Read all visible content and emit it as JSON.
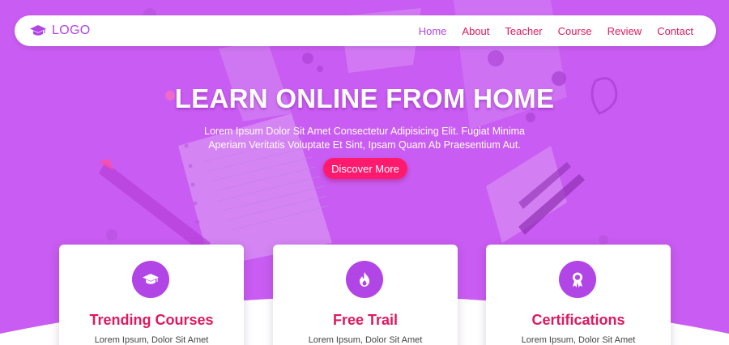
{
  "colors": {
    "hero_bg": "#c95cf2",
    "accent": "#b145e6",
    "brand_pink": "#e0185f",
    "cta_bg": "#ff1a6e"
  },
  "logo": {
    "icon": "graduation-cap-icon",
    "text": "LOGO"
  },
  "nav": {
    "items": [
      {
        "label": "Home",
        "active": true
      },
      {
        "label": "About"
      },
      {
        "label": "Teacher"
      },
      {
        "label": "Course"
      },
      {
        "label": "Review"
      },
      {
        "label": "Contact"
      }
    ]
  },
  "hero": {
    "title": "LEARN ONLINE FROM HOME",
    "text_line1": "Lorem Ipsum Dolor Sit Amet Consectetur Adipisicing Elit. Fugiat Minima",
    "text_line2": "Aperiam Veritatis Voluptate Et Sint, Ipsam Quam Ab Praesentium Aut.",
    "cta_label": "Discover More"
  },
  "cards": [
    {
      "icon": "graduation-cap-icon",
      "title": "Trending Courses",
      "text": "Lorem Ipsum, Dolor Sit Amet"
    },
    {
      "icon": "fire-icon",
      "title": "Free Trail",
      "text": "Lorem Ipsum, Dolor Sit Amet"
    },
    {
      "icon": "award-icon",
      "title": "Certifications",
      "text": "Lorem Ipsum, Dolor Sit Amet"
    }
  ]
}
